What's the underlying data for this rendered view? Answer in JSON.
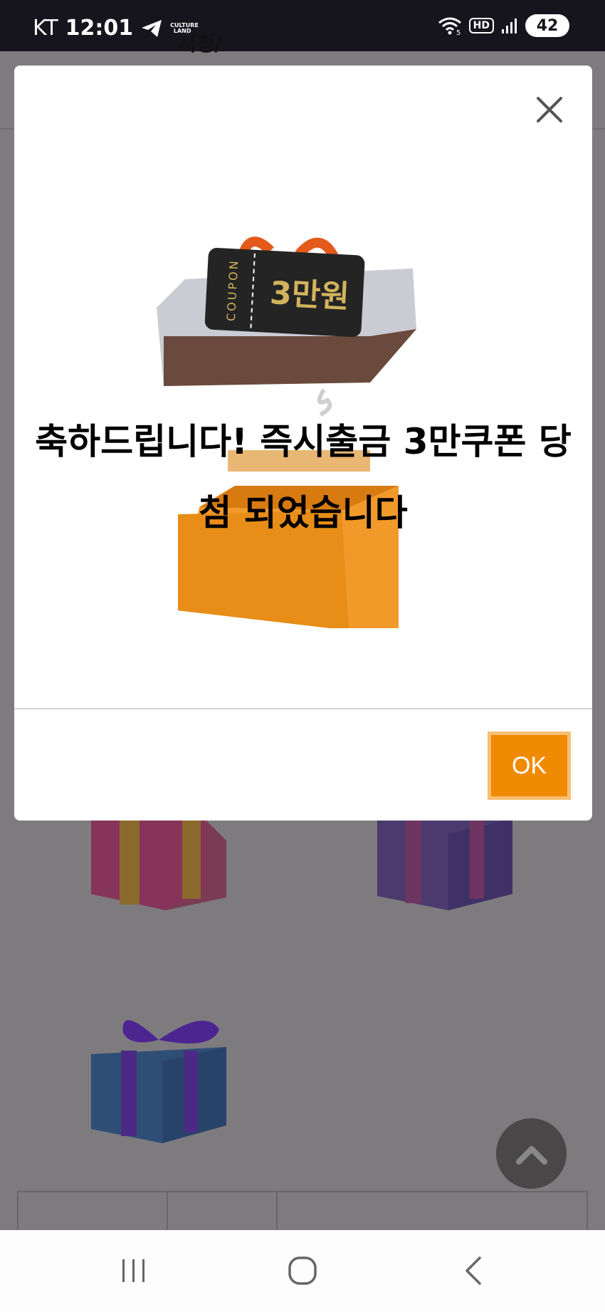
{
  "status_bar": {
    "carrier": "KT",
    "time": "12:01",
    "app_logo_text": "CULTURE LAND",
    "hd_label": "HD",
    "wifi_label": "5",
    "battery": "42",
    "icons": [
      "telegram-icon",
      "wifi-icon",
      "hd-icon",
      "signal-icon",
      "battery-icon"
    ]
  },
  "modal": {
    "message": "축하드립니다! 즉시출금 3만쿠폰 당첨 되었습니다",
    "coupon_label": "COUPON",
    "coupon_amount": "3만원",
    "ok_label": "OK",
    "close_icon": "close-icon",
    "accent_color": "#f08a00"
  },
  "background": {
    "table_text": "시청/",
    "gifts": [
      "pink-gift",
      "purple-gift",
      "blue-gift"
    ]
  },
  "nav": {
    "icons": [
      "recent-apps-icon",
      "home-icon",
      "back-icon"
    ]
  }
}
